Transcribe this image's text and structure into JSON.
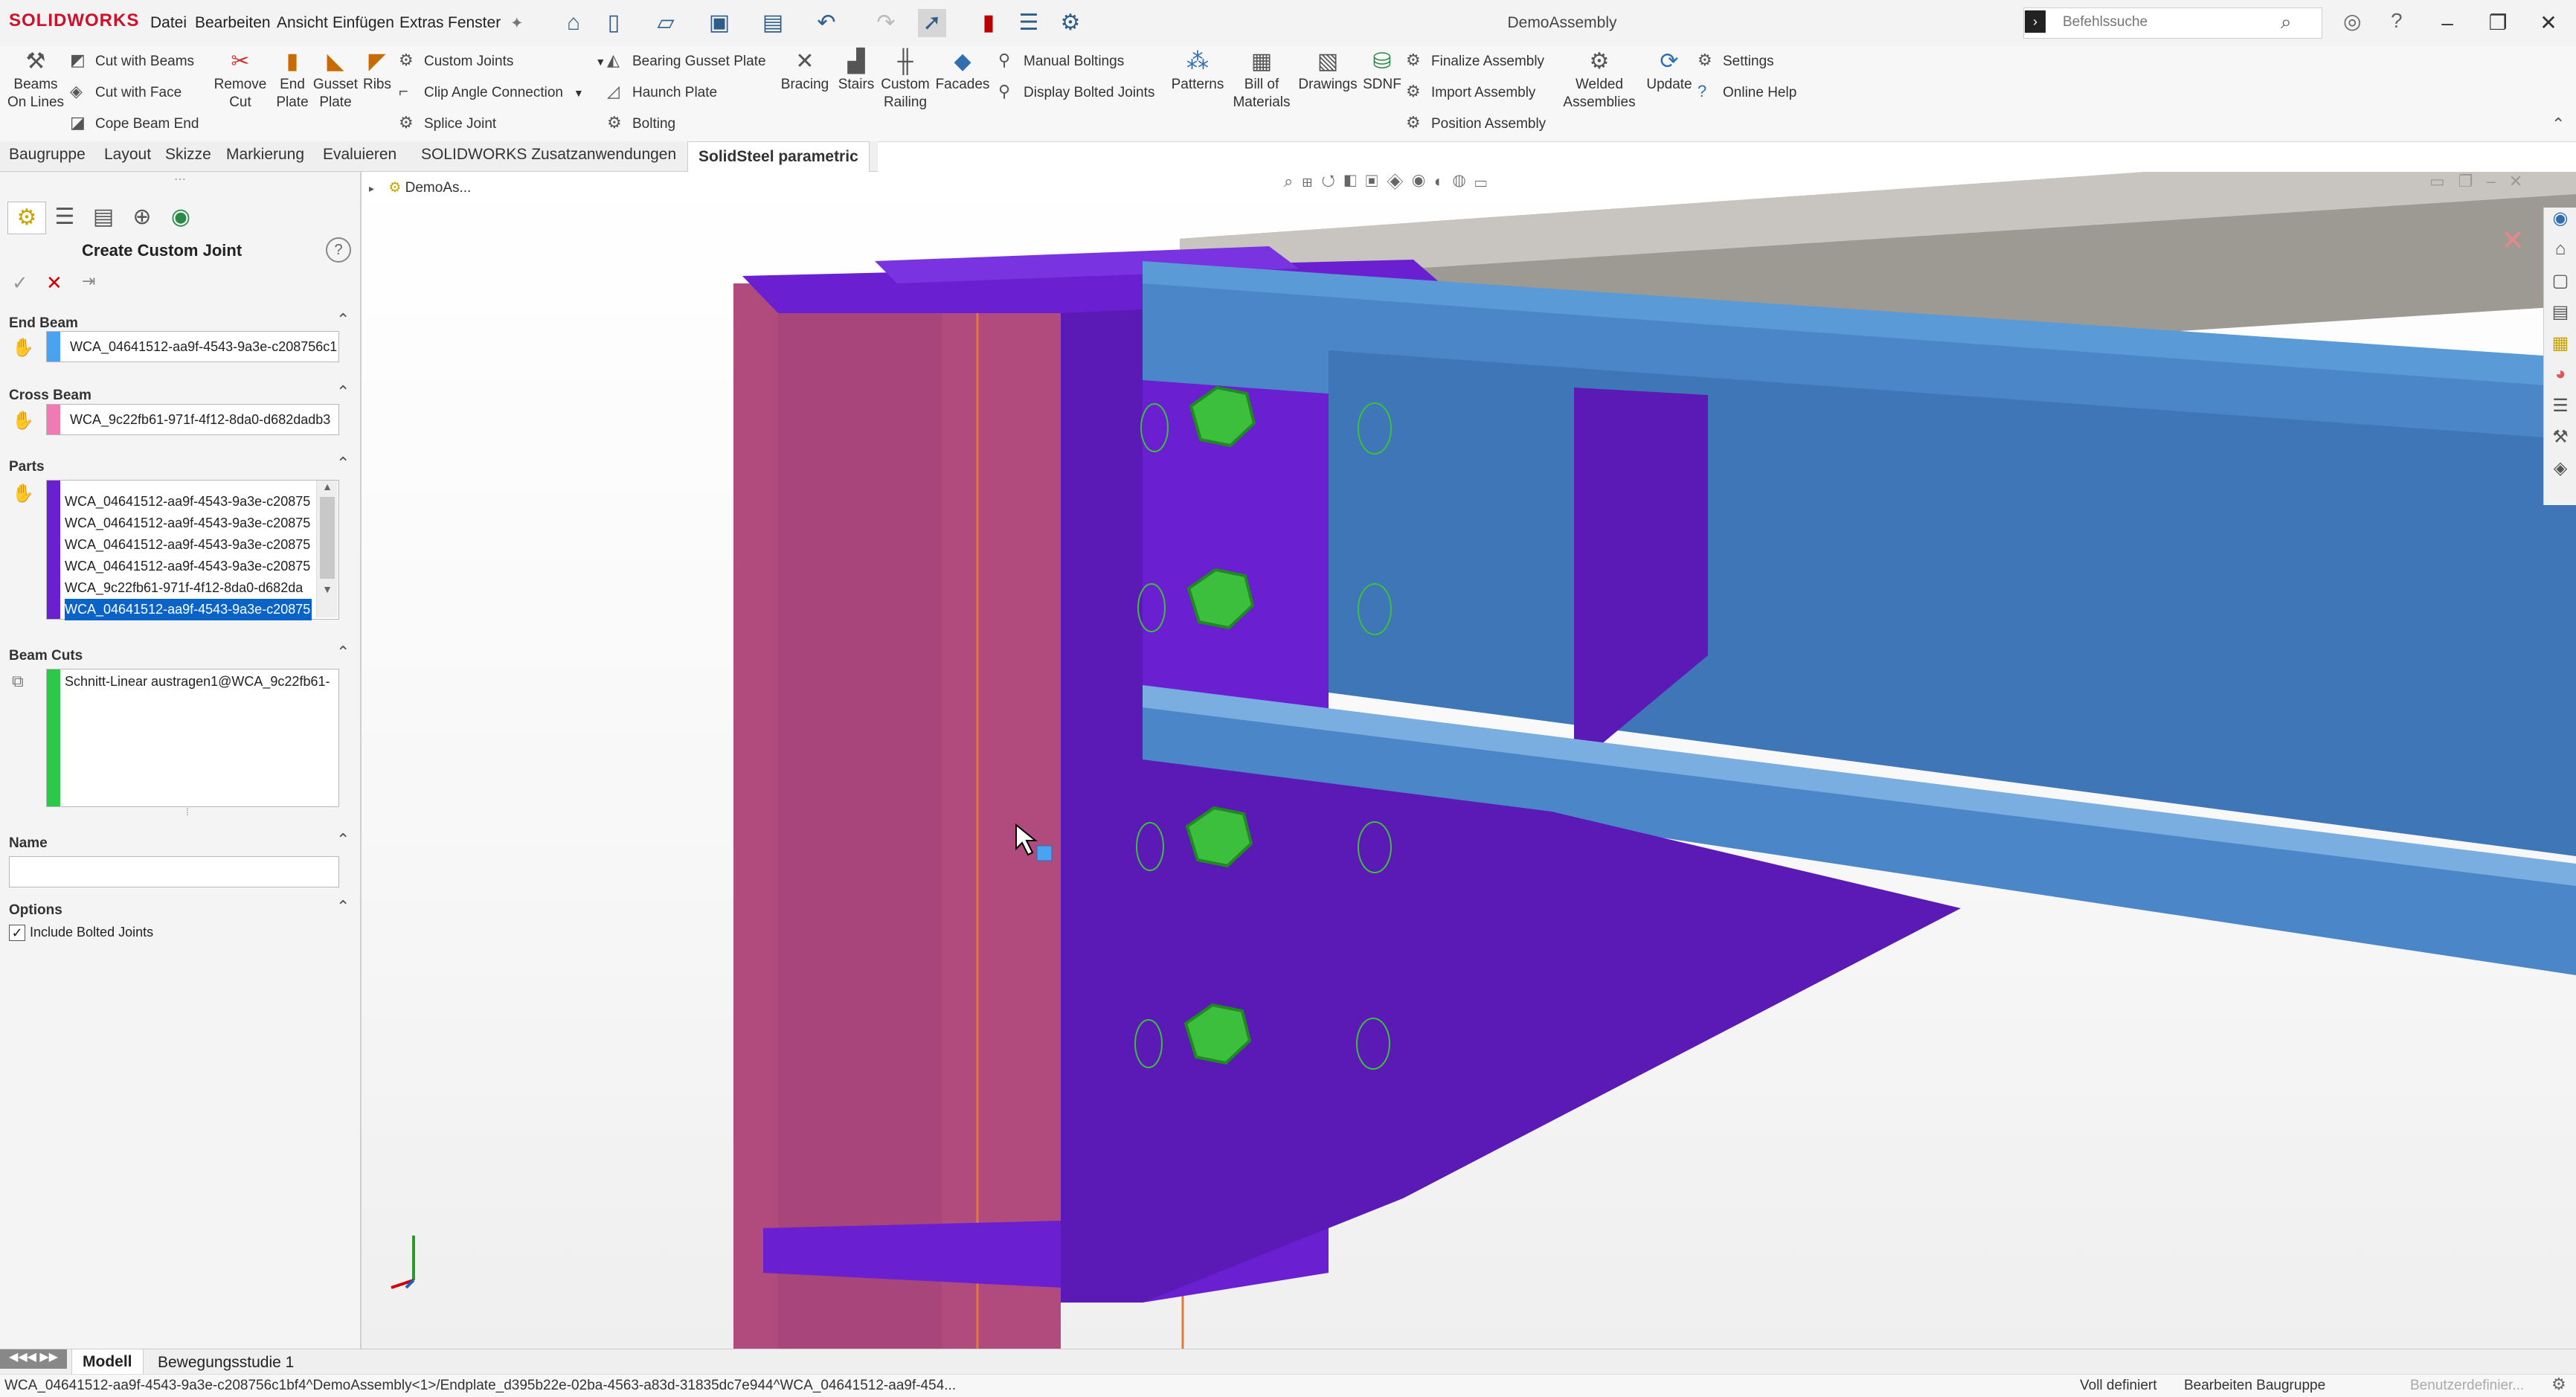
{
  "app": {
    "logo": "SOLIDWORKS",
    "window_title": "DemoAssembly"
  },
  "menu": [
    "Datei",
    "Bearbeiten",
    "Ansicht",
    "Einfügen",
    "Extras",
    "Fenster"
  ],
  "search": {
    "placeholder": "Befehlssuche"
  },
  "ribbon": {
    "beams_on_lines": [
      "Beams",
      "On Lines"
    ],
    "cut_with_beams": "Cut with Beams",
    "cut_with_face": "Cut with Face",
    "cope_beam_end": "Cope Beam End",
    "remove_cut": [
      "Remove",
      "Cut"
    ],
    "end_plate": [
      "End",
      "Plate"
    ],
    "gusset_plate": [
      "Gusset",
      "Plate"
    ],
    "ribs": "Ribs",
    "custom_joints": "Custom Joints",
    "clip_angle": "Clip Angle Connection",
    "splice_joint": "Splice Joint",
    "bearing_gusset": "Bearing Gusset Plate",
    "haunch_plate": "Haunch Plate",
    "bolting": "Bolting",
    "bracing": "Bracing",
    "stairs": "Stairs",
    "custom_railing": [
      "Custom",
      "Railing"
    ],
    "facades": "Facades",
    "manual_boltings": "Manual Boltings",
    "display_bolted": "Display Bolted Joints",
    "patterns": "Patterns",
    "bill_of_materials": [
      "Bill of",
      "Materials"
    ],
    "drawings": "Drawings",
    "sdnf": "SDNF",
    "finalize_assembly": "Finalize Assembly",
    "import_assembly": "Import Assembly",
    "position_assembly": "Position Assembly",
    "welded_assemblies": [
      "Welded",
      "Assemblies"
    ],
    "update": "Update",
    "settings": "Settings",
    "online_help": "Online Help"
  },
  "tabs": [
    "Baugruppe",
    "Layout",
    "Skizze",
    "Markierung",
    "Evaluieren",
    "SOLIDWORKS Zusatzanwendungen",
    "SolidSteel parametric"
  ],
  "tree": {
    "root": "DemoAs..."
  },
  "panel": {
    "title": "Create Custom Joint",
    "end_beam": {
      "label": "End Beam",
      "value": "WCA_04641512-aa9f-4543-9a3e-c208756c1"
    },
    "cross_beam": {
      "label": "Cross Beam",
      "value": "WCA_9c22fb61-971f-4f12-8da0-d682dadb3"
    },
    "parts": {
      "label": "Parts",
      "items": [
        "WCA_04641512-aa9f-4543-9a3e-c20875",
        "WCA_04641512-aa9f-4543-9a3e-c20875",
        "WCA_04641512-aa9f-4543-9a3e-c20875",
        "WCA_04641512-aa9f-4543-9a3e-c20875",
        "WCA_9c22fb61-971f-4f12-8da0-d682da",
        "WCA_04641512-aa9f-4543-9a3e-c20875"
      ]
    },
    "beam_cuts": {
      "label": "Beam Cuts",
      "value": "Schnitt-Linear austragen1@WCA_9c22fb61-"
    },
    "name": {
      "label": "Name",
      "value": ""
    },
    "options": {
      "label": "Options",
      "include_bolted": "Include Bolted Joints"
    }
  },
  "bottom_tabs": [
    "Modell",
    "Bewegungsstudie 1"
  ],
  "status": {
    "path": "WCA_04641512-aa9f-4543-9a3e-c208756c1bf4^DemoAssembly<1>/Endplate_d395b22e-02ba-4563-a83d-31835dc7e944^WCA_04641512-aa9f-454...",
    "defined": "Voll definiert",
    "editing": "Bearbeiten Baugruppe",
    "custom": "Benutzerdefinier..."
  },
  "colors": {
    "column": "#b14a7d",
    "endplate": "#6a1fd0",
    "beam": "#4a86c8",
    "bolt": "#3cbf3c",
    "beam_cuts_swatch": "#2bc84a",
    "end_beam_swatch": "#4aa3f0",
    "cross_beam_swatch": "#f07ab4",
    "parts_swatch": "#6a1fd0"
  }
}
